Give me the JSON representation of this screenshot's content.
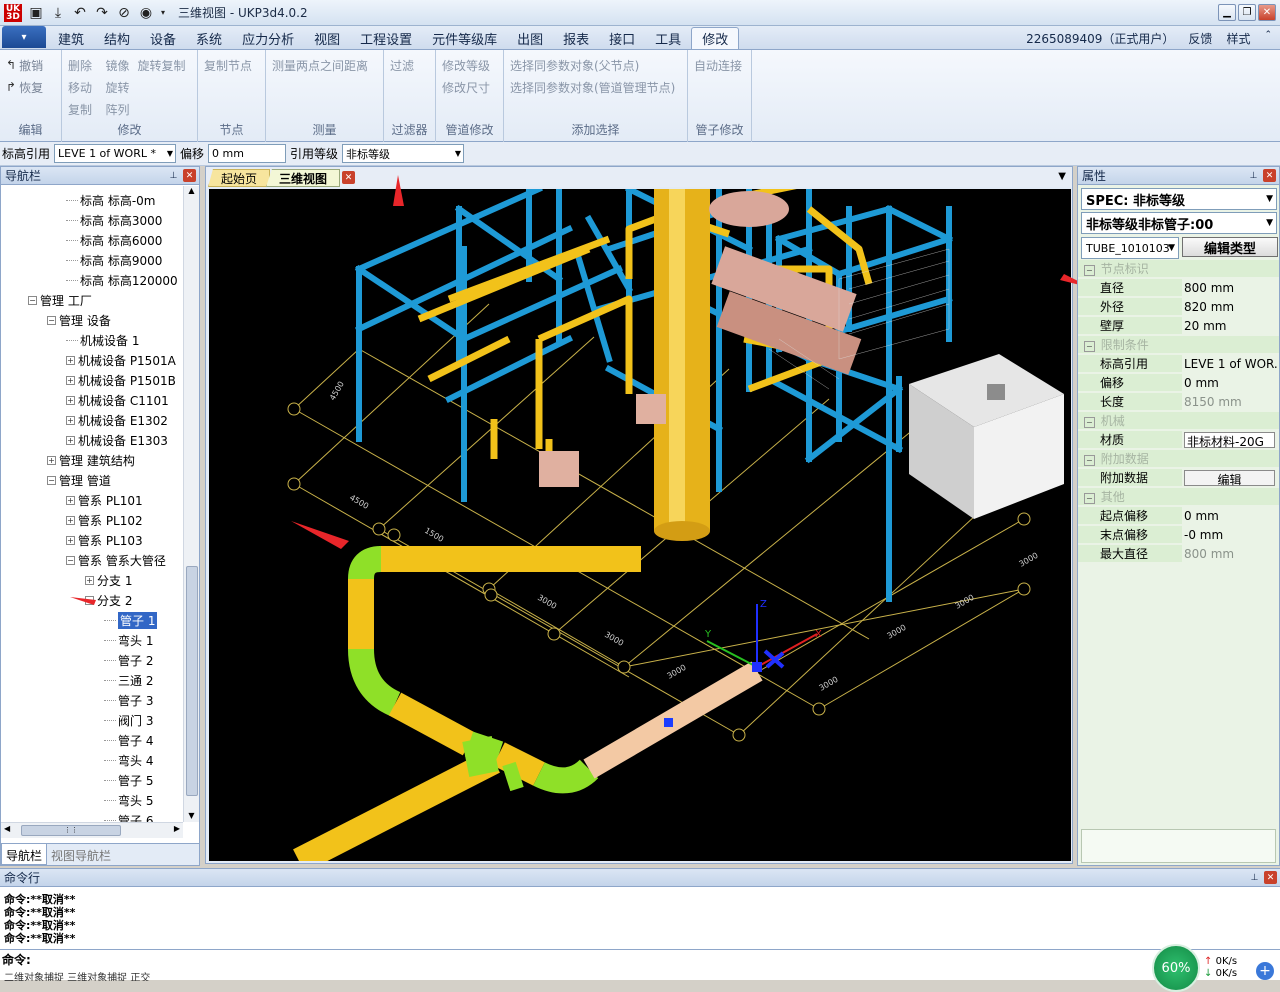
{
  "window": {
    "title": "三维视图 - UKP3d4.0.2",
    "logo_text": "UK\nP3D"
  },
  "menubar": {
    "tabs": [
      "建筑",
      "结构",
      "设备",
      "系统",
      "应力分析",
      "视图",
      "工程设置",
      "元件等级库",
      "出图",
      "报表",
      "接口",
      "工具",
      "修改"
    ],
    "active": "修改",
    "user": "2265089409（正式用户）",
    "feedback": "反馈",
    "style": "样式"
  },
  "ribbon": {
    "edit": {
      "undo": "撤销",
      "redo": "恢复",
      "caption": "编辑"
    },
    "modify": {
      "delete": "删除",
      "mirror": "镜像",
      "rotate_copy": "旋转复制",
      "move": "移动",
      "rotate": "旋转",
      "copy": "复制",
      "array": "阵列",
      "caption": "修改"
    },
    "node": {
      "copy_node": "复制节点",
      "caption": "节点"
    },
    "measure": {
      "measure_distance": "测量两点之间距离",
      "caption": "测量"
    },
    "filter": {
      "filter": "过滤",
      "caption": "过滤器"
    },
    "pipe_modify": {
      "modify_grade": "修改等级",
      "modify_size": "修改尺寸",
      "caption": "管道修改"
    },
    "add_select": {
      "select_parent": "选择同参数对象(父节点)",
      "select_pipe_node": "选择同参数对象(管道管理节点)",
      "caption": "添加选择"
    },
    "tube_modify": {
      "auto_connect": "自动连接",
      "caption": "管子修改"
    }
  },
  "propbar": {
    "elev_label": "标高引用",
    "elev_value": "LEVE 1 of WORL *",
    "offset_label": "偏移",
    "offset_value": "0 mm",
    "grade_label": "引用等级",
    "grade_value": "非标等级"
  },
  "nav": {
    "title": "导航栏",
    "tabs": [
      "导航栏",
      "视图导航栏"
    ],
    "tree": [
      {
        "label": "标高 标高-0m",
        "level": 3,
        "expander": ""
      },
      {
        "label": "标高 标高3000",
        "level": 3,
        "expander": ""
      },
      {
        "label": "标高 标高6000",
        "level": 3,
        "expander": ""
      },
      {
        "label": "标高 标高9000",
        "level": 3,
        "expander": ""
      },
      {
        "label": "标高 标高120000",
        "level": 3,
        "expander": ""
      },
      {
        "label": "管理 工厂",
        "level": 1,
        "expander": "−"
      },
      {
        "label": "管理 设备",
        "level": 2,
        "expander": "−"
      },
      {
        "label": "机械设备 1",
        "level": 3,
        "expander": ""
      },
      {
        "label": "机械设备 P1501A",
        "level": 3,
        "expander": "+"
      },
      {
        "label": "机械设备 P1501B",
        "level": 3,
        "expander": "+"
      },
      {
        "label": "机械设备 C1101",
        "level": 3,
        "expander": "+"
      },
      {
        "label": "机械设备 E1302",
        "level": 3,
        "expander": "+"
      },
      {
        "label": "机械设备 E1303",
        "level": 3,
        "expander": "+"
      },
      {
        "label": "管理 建筑结构",
        "level": 2,
        "expander": "+"
      },
      {
        "label": "管理 管道",
        "level": 2,
        "expander": "−"
      },
      {
        "label": "管系 PL101",
        "level": 3,
        "expander": "+"
      },
      {
        "label": "管系 PL102",
        "level": 3,
        "expander": "+"
      },
      {
        "label": "管系 PL103",
        "level": 3,
        "expander": "+"
      },
      {
        "label": "管系 管系大管径",
        "level": 3,
        "expander": "−"
      },
      {
        "label": "分支 1",
        "level": 4,
        "expander": "+"
      },
      {
        "label": "分支 2",
        "level": 4,
        "expander": "−"
      },
      {
        "label": "管子 1",
        "level": 5,
        "expander": "",
        "selected": true
      },
      {
        "label": "弯头 1",
        "level": 5,
        "expander": ""
      },
      {
        "label": "管子 2",
        "level": 5,
        "expander": ""
      },
      {
        "label": "三通 2",
        "level": 5,
        "expander": ""
      },
      {
        "label": "管子 3",
        "level": 5,
        "expander": ""
      },
      {
        "label": "阀门 3",
        "level": 5,
        "expander": ""
      },
      {
        "label": "管子 4",
        "level": 5,
        "expander": ""
      },
      {
        "label": "弯头 4",
        "level": 5,
        "expander": ""
      },
      {
        "label": "管子 5",
        "level": 5,
        "expander": ""
      },
      {
        "label": "弯头 5",
        "level": 5,
        "expander": ""
      },
      {
        "label": "管子 6",
        "level": 5,
        "expander": ""
      }
    ]
  },
  "view": {
    "tabs": [
      "起始页",
      "三维视图"
    ],
    "active": "三维视图",
    "dims": [
      "4500",
      "1500",
      "3000",
      "3000",
      "3000",
      "3000",
      "3000",
      "3000",
      "3000",
      "4500"
    ],
    "axes": {
      "x": "X",
      "y": "Y",
      "z": "Z"
    }
  },
  "props": {
    "title": "属性",
    "spec": "SPEC: 非标等级",
    "grade": "非标等级非标管子:00",
    "type_code": "TUBE_1010103",
    "edit_type": "编辑类型",
    "rows": [
      {
        "cat": "节点标识"
      },
      {
        "k": "直径",
        "v": "800 mm"
      },
      {
        "k": "外径",
        "v": "820 mm"
      },
      {
        "k": "壁厚",
        "v": "20 mm"
      },
      {
        "cat": "限制条件"
      },
      {
        "k": "标高引用",
        "v": "LEVE 1 of WOR..."
      },
      {
        "k": "偏移",
        "v": "0 mm"
      },
      {
        "k": "长度",
        "v": "8150 mm",
        "muted": true
      },
      {
        "cat": "机械"
      },
      {
        "k": "材质",
        "v": "非标材料-20G",
        "box": true
      },
      {
        "cat": "附加数据"
      },
      {
        "k": "附加数据",
        "v": "编辑",
        "button": true
      },
      {
        "cat": "其他"
      },
      {
        "k": "起点偏移",
        "v": "0 mm"
      },
      {
        "k": "末点偏移",
        "v": "-0 mm"
      },
      {
        "k": "最大直径",
        "v": "800 mm",
        "muted": true
      }
    ]
  },
  "cmd": {
    "title": "命令行",
    "lines": [
      "命令:**取消**",
      "命令:**取消**",
      "命令:**取消**",
      "命令:**取消**"
    ],
    "prompt": "命令:",
    "status": "二维对象捕捉    三维对象捕捉    正交"
  },
  "tray": {
    "percent": "60%",
    "up": "0K/s",
    "down": "0K/s"
  },
  "colors": {
    "steel": "#1e9ad6",
    "pipe_yellow": "#f2c21a",
    "elbow_green": "#8fe028",
    "selected_pipe": "#f3c9a4",
    "equipment": "#d9a79a",
    "grid": "#c9b24a"
  }
}
